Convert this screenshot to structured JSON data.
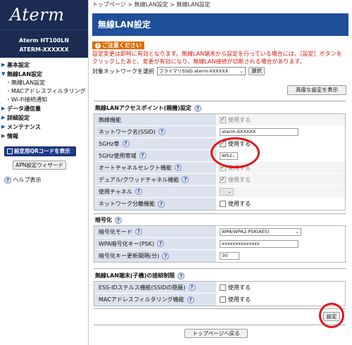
{
  "brand": {
    "logo": "Aterm",
    "model": "Aterm HT100LN",
    "device_id": "ATERM-XXXXXX"
  },
  "sidebar": {
    "items": [
      {
        "label": "基本設定"
      },
      {
        "label": "無線LAN設定",
        "children": [
          "無線LAN設定",
          "MACアドレスフィルタリング",
          "Wi-Fi接続通知"
        ]
      },
      {
        "label": "データ通信量"
      },
      {
        "label": "詳細設定"
      },
      {
        "label": "メンテナンス"
      },
      {
        "label": "情報"
      }
    ],
    "qr_button": "設定用QRコードを表示",
    "apn_button": "APN設定ウィザード",
    "help": "ヘルプ表示"
  },
  "breadcrumb": "トップページ > 無線LAN設定 > 無線LAN設定",
  "page_title": "無線LAN設定",
  "notice": {
    "badge": "ご注意ください",
    "text": "設定変更は即時に有効となります。無線LAN端末から設定を行っている場合には、［設定］ボタンをクリックしたあと、変更が有効になり、無線LAN接続が切断される場合があります。"
  },
  "target_network": {
    "label": "対象ネットワークを選択",
    "value": "プライマリSSID:aterm-XXXXXX",
    "select_button": "選択"
  },
  "advanced_button": "高度な設定を表示",
  "sections": {
    "ap": {
      "title": "無線LANアクセスポイント(親機)設定",
      "rows": {
        "wireless_func": {
          "label": "無線機能",
          "value": "使用する"
        },
        "ssid": {
          "label": "ネットワーク名(SSID)",
          "value": "aterm-XXXXXX"
        },
        "band5": {
          "label": "5GHz帯",
          "value": "使用する"
        },
        "band5_channel": {
          "label": "5GHz使用帯域",
          "value": "W52"
        },
        "auto_channel": {
          "label": "オートチャネルセレクト機能",
          "value": "使用する"
        },
        "dual_channel": {
          "label": "デュアル/クワッドチャネル機能",
          "value": "使用する"
        },
        "channel": {
          "label": "使用チャネル",
          "value": ""
        },
        "separator": {
          "label": "ネットワーク分離機能",
          "value": "使用する"
        }
      }
    },
    "encryption": {
      "title": "暗号化",
      "rows": {
        "mode": {
          "label": "暗号化モード",
          "value": "WPA/WPA2-PSK(AES)"
        },
        "key": {
          "label": "WPA暗号化キー(PSK)",
          "value": "xxxxxxxxxxxxxx"
        },
        "interval": {
          "label": "暗号化キー更新間隔(分)",
          "value": "30"
        }
      }
    },
    "client": {
      "title": "無線LAN端末(子機)の接続制限",
      "rows": {
        "stealth": {
          "label": "ESS-IDステルス機能(SSIDの隠蔽)",
          "value": "使用する"
        },
        "mac": {
          "label": "MACアドレスフィルタリング機能",
          "value": "使用する"
        }
      }
    }
  },
  "save_button": "設定",
  "top_button": "トップページへ戻る",
  "colors": {
    "title_bar": "#1e4f9a",
    "sidebar": "#1b2b52",
    "label_bg": "#dce3ee",
    "notice": "#d21a0e",
    "highlight": "#e3141a"
  }
}
